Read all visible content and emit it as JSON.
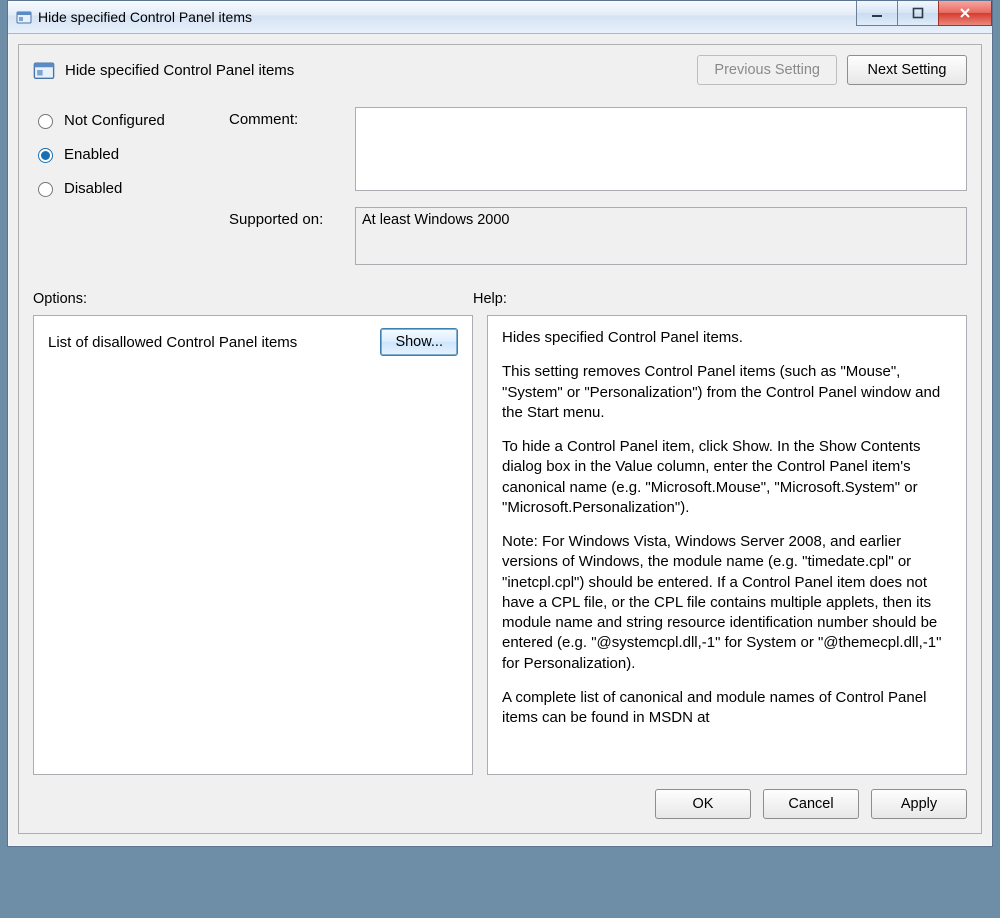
{
  "window": {
    "title": "Hide specified Control Panel items"
  },
  "header": {
    "title": "Hide specified Control Panel items",
    "prev_label": "Previous Setting",
    "next_label": "Next Setting"
  },
  "state": {
    "not_configured_label": "Not Configured",
    "enabled_label": "Enabled",
    "disabled_label": "Disabled",
    "selected": "Enabled"
  },
  "fields": {
    "comment_label": "Comment:",
    "comment_value": "",
    "supported_label": "Supported on:",
    "supported_value": "At least Windows 2000"
  },
  "sections": {
    "options_label": "Options:",
    "help_label": "Help:"
  },
  "options": {
    "item_label": "List of disallowed Control Panel items",
    "show_label": "Show..."
  },
  "help": {
    "p1": "Hides specified Control Panel items.",
    "p2": "This setting removes Control Panel items (such as \"Mouse\", \"System\" or \"Personalization\") from the Control Panel window and the Start menu.",
    "p3": "To hide a Control Panel item, click Show. In the Show Contents dialog box in the Value column, enter the Control Panel item's canonical name (e.g. \"Microsoft.Mouse\", \"Microsoft.System\" or \"Microsoft.Personalization\").",
    "p4": "Note: For Windows Vista, Windows Server 2008, and earlier versions of Windows, the module name (e.g. \"timedate.cpl\" or \"inetcpl.cpl\") should be entered. If a Control Panel item does not have a CPL file, or the CPL file contains multiple applets, then its module name and string resource identification number should be entered (e.g. \"@systemcpl.dll,-1\" for System or \"@themecpl.dll,-1\" for Personalization).",
    "p5": "A complete list of canonical and module names of Control Panel items can be found in MSDN at"
  },
  "footer": {
    "ok_label": "OK",
    "cancel_label": "Cancel",
    "apply_label": "Apply"
  }
}
